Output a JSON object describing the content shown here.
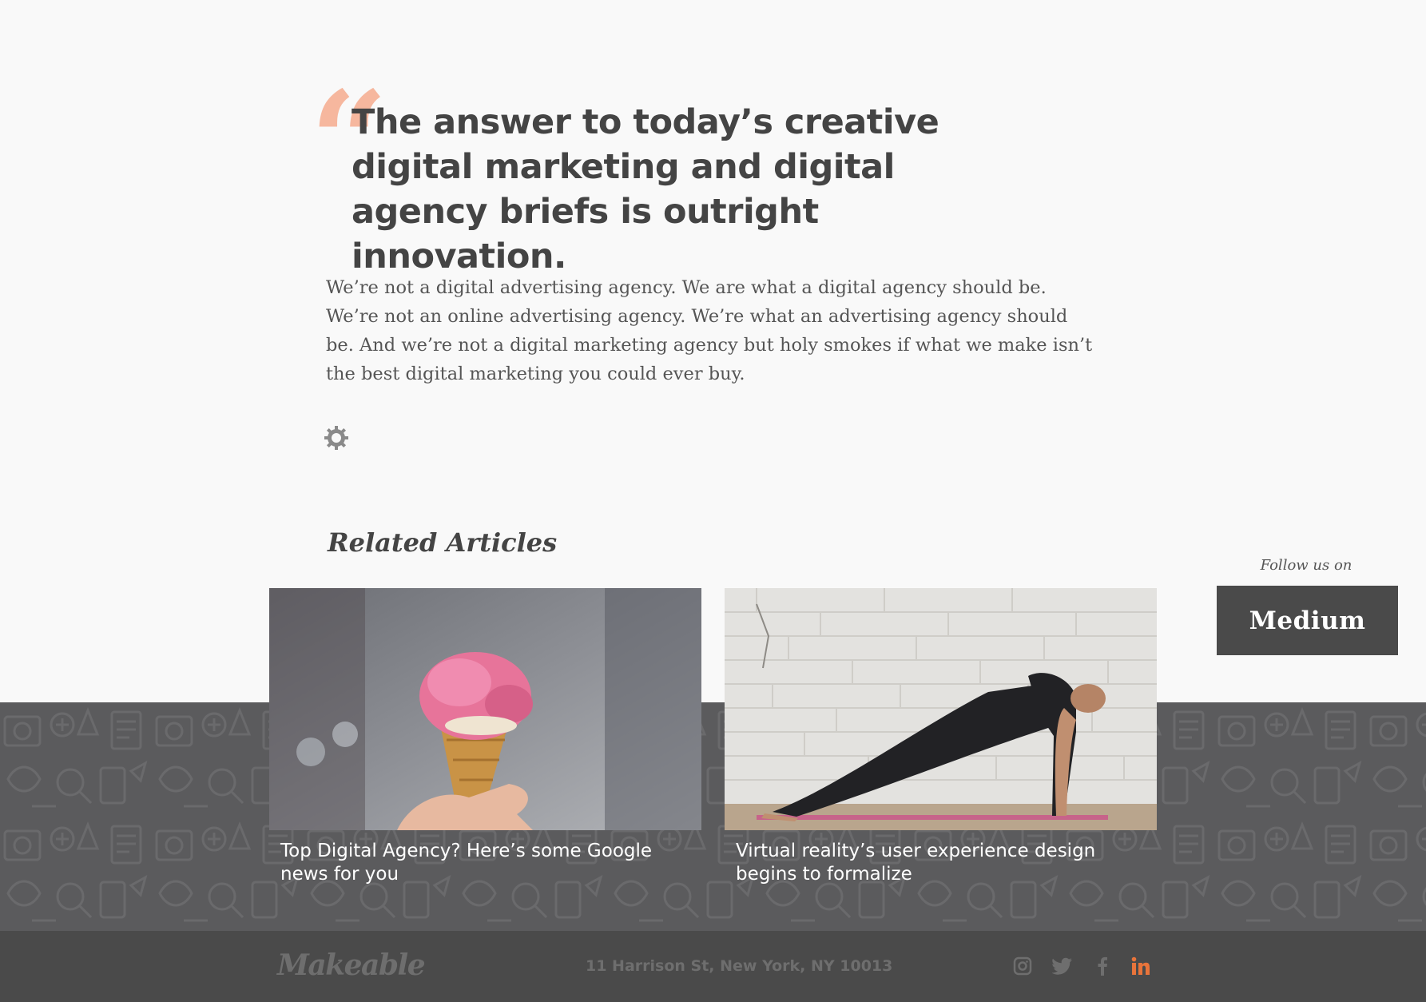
{
  "quote": {
    "mark": "“",
    "text": "The answer to today’s creative digital marketing and digital agency briefs is outright innovation."
  },
  "intro": "We’re not a digital advertising agency.  We are what a digital agency should be. We’re not an online advertising agency. We’re what an advertising agency should be. And we’re not a digital marketing agency but holy smokes if what we make isn’t the best digital marketing you could ever buy.",
  "related": {
    "title": "Related Articles",
    "articles": [
      {
        "title": "Top Digital Agency? Here’s some Google news for you"
      },
      {
        "title": "Virtual reality’s user experience design begins to formalize"
      }
    ]
  },
  "follow": {
    "label": "Follow us on",
    "button": "Medium"
  },
  "footer": {
    "logo": "Makeable",
    "address": "11 Harrison St, New York, NY 10013"
  },
  "colors": {
    "accent": "#f6b79e",
    "linkedin": "#e8743b",
    "dark": "#4a4a4a",
    "pattern": "#5b5b5d"
  },
  "icons": [
    "quote-icon",
    "gear-icon",
    "instagram-icon",
    "twitter-icon",
    "facebook-icon",
    "linkedin-icon"
  ]
}
